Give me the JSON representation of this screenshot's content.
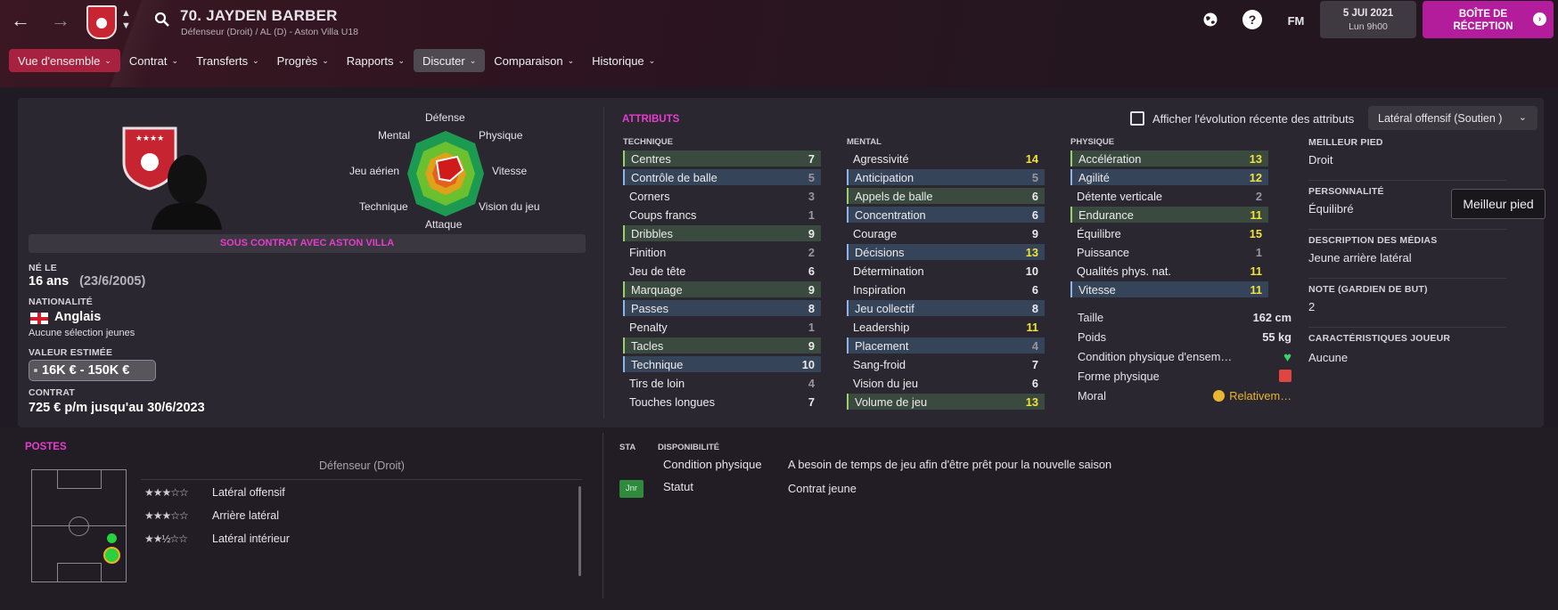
{
  "header": {
    "player_name": "70. JAYDEN BARBER",
    "player_sub": "Défenseur (Droit) / AL (D) - Aston Villa U18",
    "fm": "FM",
    "date": "5 JUI 2021",
    "time": "Lun 9h00",
    "inbox": "BOÎTE DE RÉCEPTION",
    "back": "←",
    "forward": "→"
  },
  "tabs": [
    {
      "label": "Vue d'ensemble"
    },
    {
      "label": "Contrat"
    },
    {
      "label": "Transferts"
    },
    {
      "label": "Progrès"
    },
    {
      "label": "Rapports"
    },
    {
      "label": "Discuter"
    },
    {
      "label": "Comparaison"
    },
    {
      "label": "Historique"
    }
  ],
  "radar": {
    "top": "Défense",
    "tl": "Mental",
    "tr": "Physique",
    "l": "Jeu aérien",
    "r": "Vitesse",
    "bl": "Technique",
    "br": "Vision du jeu",
    "bottom": "Attaque"
  },
  "profile": {
    "contract_banner": "SOUS CONTRAT AVEC ASTON VILLA",
    "born_label": "NÉ LE",
    "age": "16 ans",
    "dob": "(23/6/2005)",
    "nat_label": "NATIONALITÉ",
    "nationality": "Anglais",
    "caps": "Aucune sélection jeunes",
    "value_label": "VALEUR ESTIMÉE",
    "value": "16K € - 150K €",
    "contract_label": "CONTRAT",
    "contract": "725 € p/m jusqu'au 30/6/2023"
  },
  "attributes": {
    "title": "ATTRIBUTS",
    "show_evolution": "Afficher l'évolution récente des attributs",
    "role": "Latéral offensif (Soutien )",
    "technique_title": "TECHNIQUE",
    "mental_title": "MENTAL",
    "physique_title": "PHYSIQUE",
    "technique": [
      {
        "name": "Centres",
        "v": "7",
        "s": "g"
      },
      {
        "name": "Contrôle de balle",
        "v": "5",
        "s": "b m"
      },
      {
        "name": "Corners",
        "v": "3",
        "s": "m"
      },
      {
        "name": "Coups francs",
        "v": "1",
        "s": "m"
      },
      {
        "name": "Dribbles",
        "v": "9",
        "s": "g"
      },
      {
        "name": "Finition",
        "v": "2",
        "s": "m"
      },
      {
        "name": "Jeu de tête",
        "v": "6",
        "s": ""
      },
      {
        "name": "Marquage",
        "v": "9",
        "s": "g"
      },
      {
        "name": "Passes",
        "v": "8",
        "s": "b"
      },
      {
        "name": "Penalty",
        "v": "1",
        "s": "m"
      },
      {
        "name": "Tacles",
        "v": "9",
        "s": "g"
      },
      {
        "name": "Technique",
        "v": "10",
        "s": "b"
      },
      {
        "name": "Tirs de loin",
        "v": "4",
        "s": "m"
      },
      {
        "name": "Touches longues",
        "v": "7",
        "s": ""
      }
    ],
    "mental": [
      {
        "name": "Agressivité",
        "v": "14",
        "s": "y"
      },
      {
        "name": "Anticipation",
        "v": "5",
        "s": "b m"
      },
      {
        "name": "Appels de balle",
        "v": "6",
        "s": "g"
      },
      {
        "name": "Concentration",
        "v": "6",
        "s": "b"
      },
      {
        "name": "Courage",
        "v": "9",
        "s": ""
      },
      {
        "name": "Décisions",
        "v": "13",
        "s": "b y"
      },
      {
        "name": "Détermination",
        "v": "10",
        "s": ""
      },
      {
        "name": "Inspiration",
        "v": "6",
        "s": ""
      },
      {
        "name": "Jeu collectif",
        "v": "8",
        "s": "b"
      },
      {
        "name": "Leadership",
        "v": "11",
        "s": "y"
      },
      {
        "name": "Placement",
        "v": "4",
        "s": "b m"
      },
      {
        "name": "Sang-froid",
        "v": "7",
        "s": ""
      },
      {
        "name": "Vision du jeu",
        "v": "6",
        "s": ""
      },
      {
        "name": "Volume de jeu",
        "v": "13",
        "s": "g y"
      }
    ],
    "physique": [
      {
        "name": "Accélération",
        "v": "13",
        "s": "g y"
      },
      {
        "name": "Agilité",
        "v": "12",
        "s": "b y"
      },
      {
        "name": "Détente verticale",
        "v": "2",
        "s": "m"
      },
      {
        "name": "Endurance",
        "v": "11",
        "s": "g y"
      },
      {
        "name": "Équilibre",
        "v": "15",
        "s": "y"
      },
      {
        "name": "Puissance",
        "v": "1",
        "s": "m"
      },
      {
        "name": "Qualités phys. nat.",
        "v": "11",
        "s": "y"
      },
      {
        "name": "Vitesse",
        "v": "11",
        "s": "b y"
      }
    ],
    "stats": [
      {
        "k": "Taille",
        "v": "162 cm"
      },
      {
        "k": "Poids",
        "v": "55 kg"
      },
      {
        "k": "Condition physique d'ensem…",
        "v": "♥"
      },
      {
        "k": "Forme physique",
        "v": "■"
      },
      {
        "k": "Moral",
        "v": "Relativem…"
      }
    ]
  },
  "right": {
    "foot_label": "MEILLEUR PIED",
    "foot": "Droit",
    "pers_label": "PERSONNALITÉ",
    "pers": "Équilibré",
    "media_label": "DESCRIPTION DES MÉDIAS",
    "media": "Jeune arrière latéral",
    "gk_label": "NOTE (GARDIEN DE BUT)",
    "gk": "2",
    "traits_label": "CARACTÉRISTIQUES JOUEUR",
    "traits": "Aucune",
    "tooltip": "Meilleur pied"
  },
  "positions": {
    "title": "POSTES",
    "main": "Défenseur (Droit)",
    "list": [
      {
        "stars": "★★★☆☆",
        "label": "Latéral offensif"
      },
      {
        "stars": "★★★☆☆",
        "label": "Arrière latéral"
      },
      {
        "stars": "★★½☆☆",
        "label": "Latéral intérieur"
      }
    ]
  },
  "status": {
    "sta": "STA",
    "dispo": "DISPONIBILITÉ",
    "cond_label": "Condition physique",
    "cond": "A besoin de temps de jeu afin d'être prêt pour la nouvelle saison",
    "statut_label": "Statut",
    "statut_badge": "Jnr",
    "statut": "Contrat jeune"
  }
}
